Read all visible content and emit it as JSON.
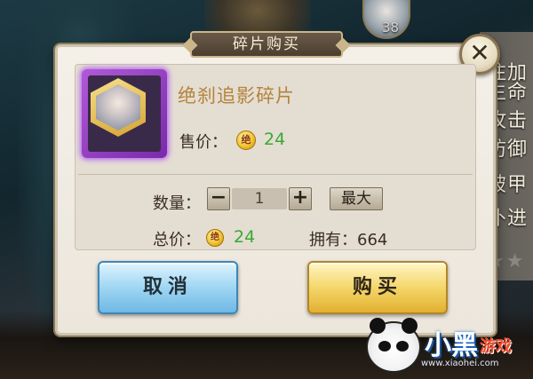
{
  "background": {
    "level": "38",
    "side_labels": [
      "注加",
      "生命",
      "攻击",
      "防御",
      "破甲",
      "仆进"
    ]
  },
  "dialog": {
    "title": "碎片购买",
    "close_label": "✕",
    "item": {
      "name": "绝刹追影碎片",
      "price_label": "售价：",
      "price_value": "24",
      "coin_glyph": "绝"
    },
    "quantity": {
      "label": "数量：",
      "minus": "−",
      "value": "1",
      "plus": "+",
      "max_label": "最大"
    },
    "total": {
      "label": "总价：",
      "value": "24",
      "own_label": "拥有：664"
    },
    "buttons": {
      "cancel": "取消",
      "buy": "购买"
    }
  },
  "watermark": {
    "text_main": "小黑",
    "text_sub": "游戏",
    "url": "www.xiaohei.com"
  },
  "colors": {
    "price_green": "#3aa834",
    "item_name_gold": "#b4833a",
    "rarity_purple": "#9a44d0"
  }
}
